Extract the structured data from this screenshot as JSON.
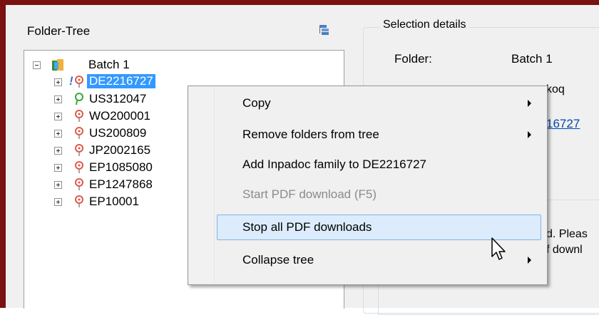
{
  "tree": {
    "title": "Folder-Tree",
    "root_label": "Batch 1",
    "nodes": [
      {
        "label": "DE2216727",
        "status": "!"
      },
      {
        "label": "US312047",
        "status": ""
      },
      {
        "label": "WO200001",
        "status": ""
      },
      {
        "label": "US200809",
        "status": ""
      },
      {
        "label": "JP2002165",
        "status": ""
      },
      {
        "label": "EP1085080",
        "status": ""
      },
      {
        "label": "EP1247868",
        "status": ""
      },
      {
        "label": "EP10001",
        "status": ""
      }
    ]
  },
  "details": {
    "group_title": "Selection details",
    "folder_label": "Folder:",
    "folder_value": "Batch 1",
    "partial_1": "koq",
    "partial_link": "16727",
    "partial_3": "d. Pleas",
    "partial_4": "f downl"
  },
  "context_menu": {
    "items": [
      {
        "label": "Copy",
        "submenu": true
      },
      {
        "label": "Remove folders from tree",
        "submenu": true
      },
      {
        "label": "Add Inpadoc family to DE2216727",
        "submenu": false
      },
      {
        "label": "Start PDF download (F5)",
        "submenu": false,
        "disabled": true
      },
      {
        "label": "Stop all PDF downloads",
        "submenu": false,
        "hover": true
      },
      {
        "label": "Collapse tree",
        "submenu": true
      }
    ]
  },
  "colors": {
    "frame": "#7a1212",
    "selection": "#3399ff",
    "menu_hover": "#dcecfc",
    "green_icon": "#3aa63a",
    "pin_icon": "#e05a47"
  }
}
